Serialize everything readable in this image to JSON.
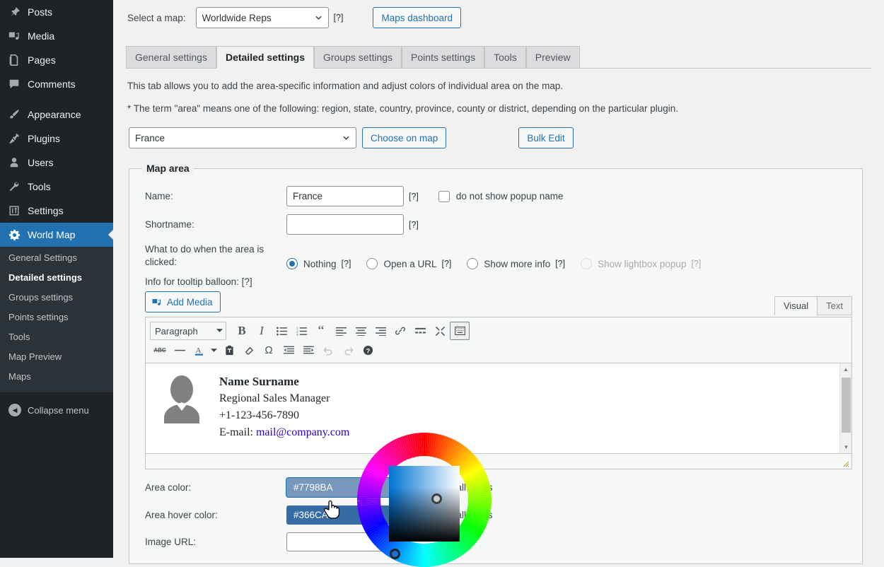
{
  "sidebar": {
    "items": [
      {
        "label": "Posts",
        "icon": "pin-icon",
        "current": false
      },
      {
        "label": "Media",
        "icon": "media-icon",
        "current": false
      },
      {
        "label": "Pages",
        "icon": "pages-icon",
        "current": false
      },
      {
        "label": "Comments",
        "icon": "comments-icon",
        "current": false
      },
      {
        "label": "Appearance",
        "icon": "brush-icon",
        "current": false
      },
      {
        "label": "Plugins",
        "icon": "plug-icon",
        "current": false
      },
      {
        "label": "Users",
        "icon": "user-icon",
        "current": false
      },
      {
        "label": "Tools",
        "icon": "wrench-icon",
        "current": false
      },
      {
        "label": "Settings",
        "icon": "sliders-icon",
        "current": false
      },
      {
        "label": "World Map",
        "icon": "gear-icon",
        "current": true
      }
    ],
    "submenu": [
      {
        "label": "General Settings",
        "current": false
      },
      {
        "label": "Detailed settings",
        "current": true
      },
      {
        "label": "Groups settings",
        "current": false
      },
      {
        "label": "Points settings",
        "current": false
      },
      {
        "label": "Tools",
        "current": false
      },
      {
        "label": "Map Preview",
        "current": false
      },
      {
        "label": "Maps",
        "current": false
      }
    ],
    "collapse_label": "Collapse menu"
  },
  "toolbar": {
    "select_map_label": "Select a map:",
    "selected_map": "Worldwide Reps",
    "map_options": [
      "Worldwide Reps"
    ],
    "help_marker": "[?]",
    "maps_dashboard_label": "Maps dashboard"
  },
  "tabs": [
    {
      "label": "General settings",
      "active": false
    },
    {
      "label": "Detailed settings",
      "active": true
    },
    {
      "label": "Groups settings",
      "active": false
    },
    {
      "label": "Points settings",
      "active": false
    },
    {
      "label": "Tools",
      "active": false
    },
    {
      "label": "Preview",
      "active": false
    }
  ],
  "tab_content": {
    "description": "This tab allows you to add the area-specific information and adjust colors of individual area on the map.",
    "note": "* The term \"area\" means one of the following: region, state, country, province, county or district, depending on the particular plugin.",
    "selected_area": "France",
    "area_options": [
      "France"
    ],
    "choose_on_map_label": "Choose on map",
    "bulk_edit_label": "Bulk Edit"
  },
  "map_area": {
    "legend": "Map area",
    "name_label": "Name:",
    "name_value": "France",
    "name_help": "[?]",
    "no_popup_name_label": "do not show popup name",
    "no_popup_name_checked": false,
    "shortname_label": "Shortname:",
    "shortname_value": "",
    "shortname_help": "[?]",
    "click_action_label": "What to do when the area is clicked:",
    "click_options": [
      {
        "label": "Nothing",
        "help": "[?]",
        "selected": true,
        "disabled": false
      },
      {
        "label": "Open a URL",
        "help": "[?]",
        "selected": false,
        "disabled": false
      },
      {
        "label": "Show more info",
        "help": "[?]",
        "selected": false,
        "disabled": false
      },
      {
        "label": "Show lightbox popup",
        "help": "[?]",
        "selected": false,
        "disabled": true
      }
    ],
    "tooltip_info_label": "Info for tooltip balloon: [?]",
    "add_media_label": "Add Media",
    "editor": {
      "visual_tab": "Visual",
      "text_tab": "Text",
      "active_tab": "Visual",
      "format_select": "Paragraph",
      "format_options": [
        "Paragraph"
      ],
      "toolbar_row1": [
        {
          "name": "bold-icon",
          "glyph": "B"
        },
        {
          "name": "italic-icon",
          "glyph": "I"
        },
        {
          "name": "bullet-list-icon",
          "glyph": "☰"
        },
        {
          "name": "numbered-list-icon",
          "glyph": "☰"
        },
        {
          "name": "blockquote-icon",
          "glyph": "“"
        },
        {
          "name": "align-left-icon",
          "glyph": "≡"
        },
        {
          "name": "align-center-icon",
          "glyph": "≡"
        },
        {
          "name": "align-right-icon",
          "glyph": "≡"
        },
        {
          "name": "insert-link-icon",
          "glyph": "🔗"
        },
        {
          "name": "read-more-icon",
          "glyph": "—"
        },
        {
          "name": "fullscreen-icon",
          "glyph": "✕"
        },
        {
          "name": "toolbar-toggle-icon",
          "glyph": "⌸"
        }
      ],
      "toolbar_row2": [
        {
          "name": "strikethrough-icon",
          "glyph": "ABC"
        },
        {
          "name": "horizontal-rule-icon",
          "glyph": "—"
        },
        {
          "name": "text-color-icon",
          "glyph": "A"
        },
        {
          "name": "paste-as-text-icon",
          "glyph": "📋"
        },
        {
          "name": "clear-formatting-icon",
          "glyph": "⬭"
        },
        {
          "name": "special-character-icon",
          "glyph": "Ω"
        },
        {
          "name": "outdent-icon",
          "glyph": "⬅"
        },
        {
          "name": "indent-icon",
          "glyph": "➡"
        },
        {
          "name": "undo-icon",
          "glyph": "↶"
        },
        {
          "name": "redo-icon",
          "glyph": "↷"
        },
        {
          "name": "keyboard-shortcuts-icon",
          "glyph": "?"
        }
      ],
      "content": {
        "avatar": "avatar-placeholder-icon",
        "name": "Name Surname",
        "title": "Regional Sales Manager",
        "phone": "+1-123-456-7890",
        "email_prefix": "E-mail: ",
        "email": "mail@company.com"
      }
    },
    "area_color_label": "Area color:",
    "area_color_value": "#7798BA",
    "area_color_apply": "Apply to all areas",
    "area_hover_color_label": "Area hover color:",
    "area_hover_color_value": "#366CA3",
    "area_hover_color_apply": "Apply to all areas",
    "image_url_label": "Image URL:",
    "image_url_value": ""
  },
  "color_picker": {
    "name": "color-wheel-picker",
    "selected_color": "#7798BA",
    "hue_marker_position": "blue",
    "sv_marker": "selected"
  },
  "colors": {
    "accent": "#2271b1",
    "sidebar_bg": "#1d2327",
    "submenu_bg": "#2c3338",
    "page_bg": "#f1f1f1",
    "area_color": "#7798BA",
    "area_hover_color": "#366CA3"
  }
}
